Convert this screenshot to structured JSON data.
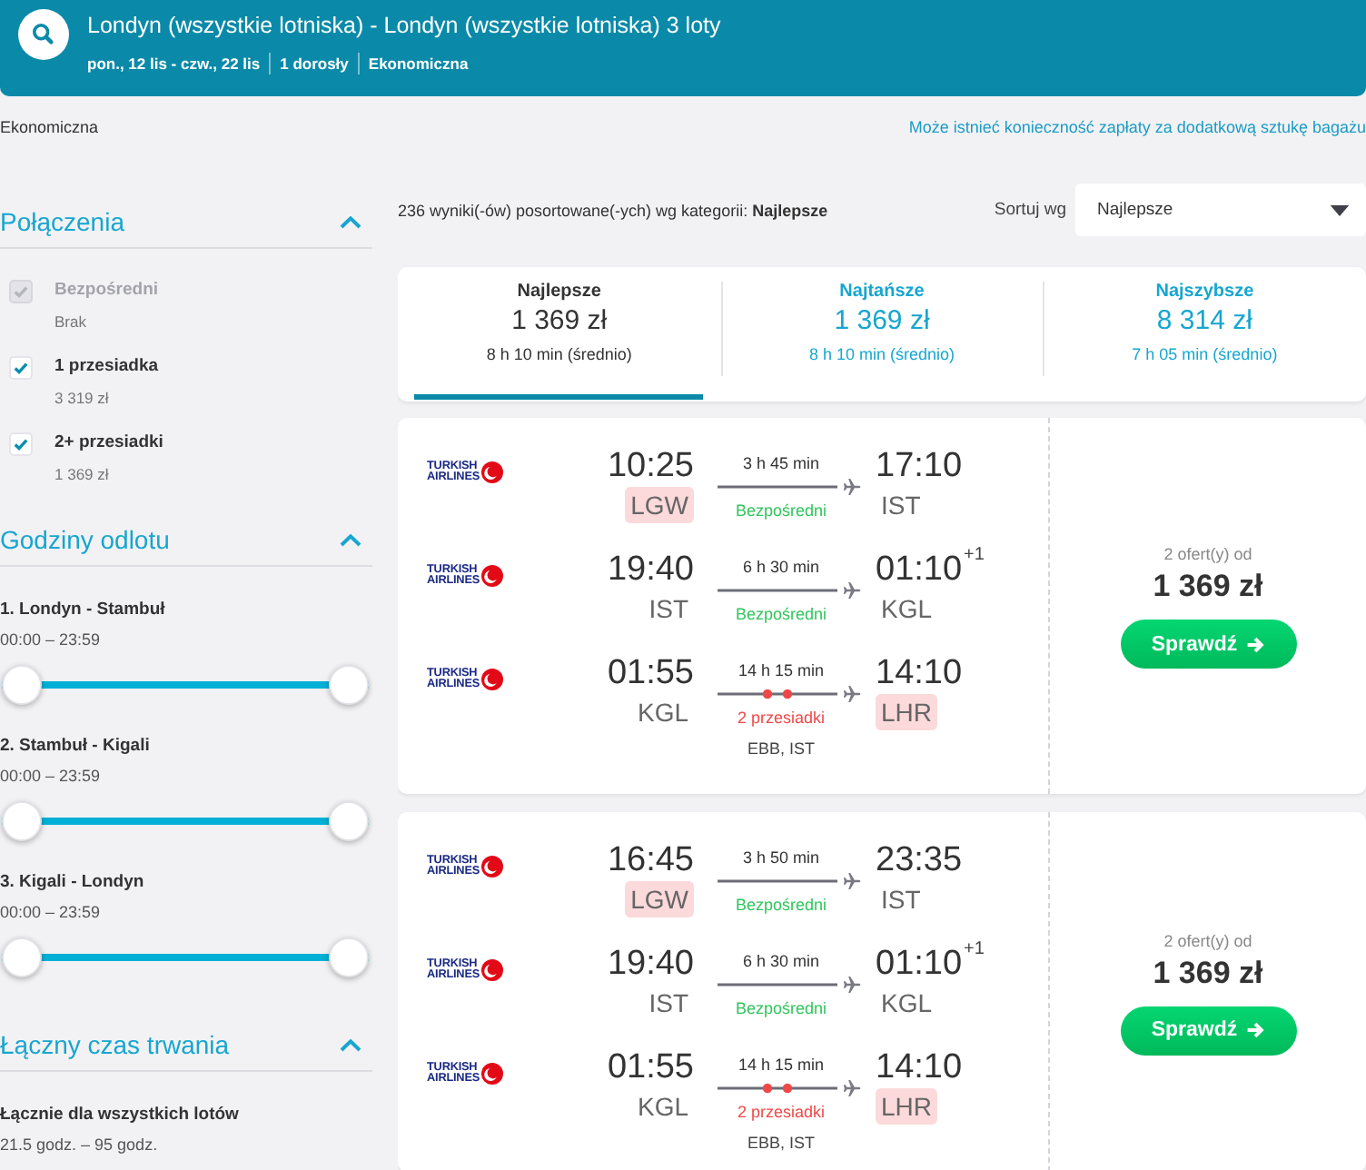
{
  "header": {
    "title": "Londyn (wszystkie lotniska) - Londyn (wszystkie lotniska) 3 loty",
    "details": [
      "pon., 12 lis - czw., 22 lis",
      "1 dorosły",
      "Ekonomiczna"
    ]
  },
  "cabin_class": "Ekonomiczna",
  "baggage_notice": "Może istnieć konieczność zapłaty za dodatkową sztukę bagażu",
  "filters": [
    {
      "kind": "checkboxes",
      "title": "Połączenia",
      "expanded": true,
      "options": [
        {
          "label": "Bezpośredni",
          "note": "Brak",
          "checked": true,
          "disabled": true
        },
        {
          "label": "1 przesiadka",
          "note": "3 319 zł",
          "checked": true,
          "disabled": false
        },
        {
          "label": "2+ przesiadki",
          "note": "1 369 zł",
          "checked": true,
          "disabled": false
        }
      ]
    },
    {
      "kind": "sliders",
      "title": "Godziny odlotu",
      "expanded": true,
      "sliders": [
        {
          "label": "1. Londyn - Stambuł",
          "range": "00:00 – 23:59",
          "level": 1
        },
        {
          "label": "2. Stambuł - Kigali",
          "range": "00:00 – 23:59",
          "level": 1
        },
        {
          "label": "3. Kigali - Londyn",
          "range": "00:00 – 23:59",
          "level": 1
        }
      ]
    },
    {
      "kind": "sliders",
      "title": "Łączny czas trwania",
      "expanded": true,
      "sliders": [
        {
          "label": "Łącznie dla wszystkich lotów",
          "range": "21.5 godz. – 95 godz."
        }
      ]
    }
  ],
  "sort": {
    "summary": "236 wyniki(-ów) posortowane(-ych) wg kategorii: **Najlepsze**",
    "label": "Sortuj wg",
    "value": "Najlepsze"
  },
  "sort_tabs": [
    {
      "label": "Najlepsze",
      "price": "1 369 zł",
      "duration": "8 h 10 min (średnio)",
      "selected": true
    },
    {
      "label": "Najtańsze",
      "price": "1 369 zł",
      "duration": "8 h 10 min (średnio)",
      "selected": false
    },
    {
      "label": "Najszybsze",
      "price": "8 314 zł",
      "duration": "7 h 05 min (średnio)",
      "selected": false
    }
  ],
  "results": [
    {
      "legs": [
        {
          "airline": "TURKISH AIRLINES",
          "depart_time": "10:25",
          "depart_airport": {
            "code": "LGW",
            "highlighted": true
          },
          "duration": "3 h 45 min",
          "kind": "direct",
          "stops_label": "Bezpośredni",
          "arrive_time": "17:10",
          "arrive_airport": {
            "code": "IST",
            "highlighted": false
          }
        },
        {
          "airline": "TURKISH AIRLINES",
          "depart_time": "19:40",
          "depart_airport": {
            "code": "IST",
            "highlighted": false
          },
          "duration": "6 h 30 min",
          "kind": "direct",
          "stops_label": "Bezpośredni",
          "arrive_time": "01:10",
          "arrive_day_offset": "+1",
          "arrive_airport": {
            "code": "KGL",
            "highlighted": false
          }
        },
        {
          "airline": "TURKISH AIRLINES",
          "depart_time": "01:55",
          "depart_airport": {
            "code": "KGL",
            "highlighted": false
          },
          "duration": "14 h 15 min",
          "kind": "connecting",
          "stops_label": "2 przesiadki",
          "via": "EBB, IST",
          "arrive_time": "14:10",
          "arrive_airport": {
            "code": "LHR",
            "highlighted": true
          }
        }
      ],
      "offers": "2 ofert(y) od",
      "price": "1 369 zł",
      "button": "Sprawdź"
    },
    {
      "legs": [
        {
          "airline": "TURKISH AIRLINES",
          "depart_time": "16:45",
          "depart_airport": {
            "code": "LGW",
            "highlighted": true
          },
          "duration": "3 h 50 min",
          "kind": "direct",
          "stops_label": "Bezpośredni",
          "arrive_time": "23:35",
          "arrive_airport": {
            "code": "IST",
            "highlighted": false
          }
        },
        {
          "airline": "TURKISH AIRLINES",
          "depart_time": "19:40",
          "depart_airport": {
            "code": "IST",
            "highlighted": false
          },
          "duration": "6 h 30 min",
          "kind": "direct",
          "stops_label": "Bezpośredni",
          "arrive_time": "01:10",
          "arrive_day_offset": "+1",
          "arrive_airport": {
            "code": "KGL",
            "highlighted": false
          }
        },
        {
          "airline": "TURKISH AIRLINES",
          "depart_time": "01:55",
          "depart_airport": {
            "code": "KGL",
            "highlighted": false
          },
          "duration": "14 h 15 min",
          "kind": "connecting",
          "stops_label": "2 przesiadki",
          "via": "EBB, IST",
          "arrive_time": "14:10",
          "arrive_airport": {
            "code": "LHR",
            "highlighted": true
          }
        }
      ],
      "offers": "2 ofert(y) od",
      "price": "1 369 zł",
      "button": "Sprawdź"
    }
  ]
}
